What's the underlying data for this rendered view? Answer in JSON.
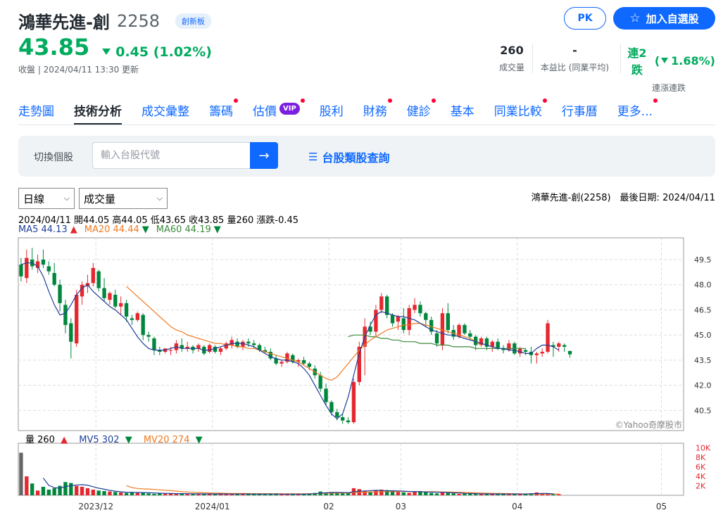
{
  "header": {
    "stock_name": "鴻華先進-創",
    "stock_code": "2258",
    "market_badge": "創新板",
    "price": "43.85",
    "change": "0.45 (1.02%)",
    "status_line": "收盤 | 2024/04/11 13:30 更新",
    "pk_label": "PK",
    "watchlist_label": "加入自選股",
    "stats": [
      {
        "value": "260",
        "label": "成交量"
      },
      {
        "value": "-",
        "label": "本益比 (同業平均)"
      }
    ],
    "streak": {
      "prefix": "連2跌",
      "value": "1.68%)",
      "open": "(",
      "label": "連漲連跌"
    }
  },
  "tabs": [
    {
      "label": "走勢圖",
      "active": false,
      "dot": false
    },
    {
      "label": "技術分析",
      "active": true,
      "dot": false
    },
    {
      "label": "成交彙整",
      "active": false,
      "dot": false
    },
    {
      "label": "籌碼",
      "active": false,
      "dot": true
    },
    {
      "label": "估價",
      "active": false,
      "dot": true,
      "vip": "VIP"
    },
    {
      "label": "股利",
      "active": false,
      "dot": false
    },
    {
      "label": "財務",
      "active": false,
      "dot": true
    },
    {
      "label": "健診",
      "active": false,
      "dot": true
    },
    {
      "label": "基本",
      "active": false,
      "dot": false
    },
    {
      "label": "同業比較",
      "active": false,
      "dot": true
    },
    {
      "label": "行事曆",
      "active": false,
      "dot": false
    },
    {
      "label": "更多...",
      "active": false,
      "dot": true
    }
  ],
  "search": {
    "label": "切換個股",
    "placeholder": "輸入台股代號",
    "category_link": "台股類股查詢"
  },
  "chart_controls": {
    "period": "日線",
    "indicator": "成交量",
    "title": "鴻華先進-創(2258)　最後日期: 2024/04/11",
    "ohlc": "2024/04/11 開44.05 高44.05 低43.65 收43.85 量260 漲跌-0.45",
    "ma5": "MA5 44.13",
    "ma20": "MA20 44.44",
    "ma60": "MA60 44.19",
    "vol": "量 260",
    "mv5": "MV5 302",
    "mv20": "MV20 274",
    "watermark": "©Yahoo奇摩股市"
  },
  "colors": {
    "up": "#e5282f",
    "down": "#00873c",
    "ma5": "#1f3f9a",
    "ma20": "#f07a22",
    "ma60": "#3b8a3b",
    "accent": "#0f69ff"
  },
  "chart_data": [
    {
      "type": "candlestick",
      "y_ticks": [
        40.5,
        42.0,
        43.5,
        45.0,
        46.5,
        48.0,
        49.5
      ],
      "ylim": [
        39.3,
        50.8
      ],
      "x_ticks": [
        "2023/12",
        "2024/01",
        "02",
        "03",
        "04",
        "05"
      ],
      "x_tick_index": [
        14,
        35,
        56,
        69,
        90,
        116
      ],
      "n_slots": 120,
      "candles": [
        [
          49.2,
          49.6,
          48.2,
          48.5
        ],
        [
          48.4,
          50.1,
          48.1,
          49.6
        ],
        [
          49.5,
          50.2,
          48.9,
          49.1
        ],
        [
          49.0,
          49.8,
          48.7,
          49.4
        ],
        [
          49.5,
          50.1,
          49.0,
          49.2
        ],
        [
          49.1,
          49.4,
          48.6,
          48.8
        ],
        [
          48.7,
          49.3,
          47.9,
          48.0
        ],
        [
          48.0,
          48.3,
          46.4,
          46.9
        ],
        [
          46.8,
          47.1,
          45.1,
          45.6
        ],
        [
          45.7,
          46.0,
          43.6,
          44.6
        ],
        [
          44.5,
          47.7,
          44.3,
          47.4
        ],
        [
          47.3,
          48.2,
          46.8,
          48.0
        ],
        [
          47.9,
          48.6,
          47.5,
          48.1
        ],
        [
          48.1,
          49.3,
          47.9,
          49.0
        ],
        [
          48.8,
          48.9,
          47.6,
          47.8
        ],
        [
          47.8,
          48.4,
          47.0,
          47.2
        ],
        [
          47.1,
          47.6,
          46.8,
          47.5
        ],
        [
          47.4,
          47.7,
          46.6,
          46.7
        ],
        [
          46.7,
          47.3,
          46.2,
          46.9
        ],
        [
          46.9,
          47.1,
          45.8,
          46.1
        ],
        [
          46.0,
          46.2,
          45.6,
          45.9
        ],
        [
          45.9,
          46.4,
          45.8,
          46.3
        ],
        [
          46.2,
          46.3,
          44.7,
          45.0
        ],
        [
          45.0,
          45.2,
          44.6,
          44.9
        ],
        [
          44.8,
          44.9,
          43.8,
          44.1
        ],
        [
          44.1,
          44.3,
          43.8,
          44.0
        ],
        [
          44.0,
          44.2,
          43.9,
          44.2
        ],
        [
          44.1,
          44.3,
          43.8,
          44.1
        ],
        [
          44.1,
          44.7,
          43.9,
          44.5
        ],
        [
          44.4,
          44.8,
          44.0,
          44.2
        ],
        [
          44.2,
          44.6,
          44.0,
          44.3
        ],
        [
          44.3,
          44.4,
          43.9,
          44.1
        ],
        [
          44.2,
          44.5,
          44.0,
          44.4
        ],
        [
          44.3,
          44.4,
          43.8,
          43.9
        ],
        [
          44.0,
          44.5,
          43.9,
          44.4
        ],
        [
          44.3,
          44.4,
          43.9,
          44.0
        ],
        [
          44.0,
          44.3,
          43.8,
          44.2
        ],
        [
          44.2,
          44.6,
          44.1,
          44.5
        ],
        [
          44.4,
          44.9,
          44.2,
          44.7
        ],
        [
          44.6,
          44.8,
          44.2,
          44.3
        ],
        [
          44.3,
          44.7,
          44.1,
          44.6
        ],
        [
          44.6,
          44.8,
          44.3,
          44.5
        ],
        [
          44.5,
          44.7,
          44.2,
          44.4
        ],
        [
          44.4,
          44.5,
          44.0,
          44.1
        ],
        [
          44.1,
          44.3,
          43.9,
          44.0
        ],
        [
          44.0,
          44.2,
          43.5,
          43.6
        ],
        [
          43.6,
          43.8,
          43.2,
          43.3
        ],
        [
          43.3,
          43.5,
          43.1,
          43.4
        ],
        [
          43.4,
          44.0,
          43.3,
          43.9
        ],
        [
          43.8,
          43.9,
          43.3,
          43.4
        ],
        [
          43.4,
          43.6,
          43.1,
          43.5
        ],
        [
          43.5,
          43.7,
          43.2,
          43.3
        ],
        [
          43.3,
          43.4,
          42.9,
          43.1
        ],
        [
          43.0,
          43.2,
          42.4,
          42.6
        ],
        [
          42.6,
          42.8,
          41.6,
          41.8
        ],
        [
          41.8,
          42.1,
          40.8,
          41.0
        ],
        [
          41.0,
          41.1,
          40.2,
          40.4
        ],
        [
          40.4,
          40.6,
          39.9,
          40.1
        ],
        [
          40.1,
          40.3,
          39.7,
          39.9
        ],
        [
          39.9,
          40.1,
          39.7,
          39.8
        ],
        [
          39.8,
          42.4,
          39.7,
          42.2
        ],
        [
          42.2,
          44.6,
          42.0,
          44.3
        ],
        [
          44.3,
          46.0,
          42.6,
          45.5
        ],
        [
          45.5,
          45.8,
          45.0,
          45.2
        ],
        [
          45.2,
          46.8,
          44.9,
          46.5
        ],
        [
          46.5,
          47.5,
          46.3,
          47.3
        ],
        [
          47.3,
          47.4,
          46.0,
          46.2
        ],
        [
          46.2,
          46.3,
          45.5,
          45.7
        ],
        [
          45.8,
          46.2,
          45.3,
          46.1
        ],
        [
          46.0,
          46.6,
          45.1,
          45.3
        ],
        [
          45.3,
          46.8,
          45.0,
          46.6
        ],
        [
          46.5,
          47.2,
          46.3,
          46.8
        ],
        [
          46.8,
          47.0,
          46.1,
          46.3
        ],
        [
          46.3,
          46.4,
          45.5,
          45.9
        ],
        [
          45.9,
          46.1,
          45.0,
          45.2
        ],
        [
          45.1,
          45.3,
          44.3,
          44.5
        ],
        [
          44.4,
          46.6,
          44.1,
          46.3
        ],
        [
          46.3,
          46.9,
          45.1,
          45.3
        ],
        [
          45.3,
          45.6,
          44.7,
          44.9
        ],
        [
          44.9,
          45.7,
          44.8,
          45.6
        ],
        [
          45.6,
          45.7,
          45.0,
          45.1
        ],
        [
          45.1,
          45.3,
          44.7,
          44.9
        ],
        [
          44.9,
          45.0,
          44.1,
          44.4
        ],
        [
          44.4,
          44.9,
          44.3,
          44.8
        ],
        [
          44.8,
          44.9,
          44.1,
          44.3
        ],
        [
          44.3,
          44.7,
          44.0,
          44.6
        ],
        [
          44.6,
          44.8,
          44.1,
          44.2
        ],
        [
          44.2,
          44.4,
          43.9,
          44.1
        ],
        [
          44.1,
          44.7,
          44.0,
          44.5
        ],
        [
          44.5,
          44.6,
          43.8,
          43.9
        ],
        [
          43.9,
          44.3,
          43.7,
          44.2
        ],
        [
          44.1,
          44.2,
          43.8,
          44.0
        ],
        [
          44.0,
          44.3,
          43.3,
          43.8
        ],
        [
          43.8,
          44.0,
          43.3,
          43.9
        ],
        [
          43.9,
          44.2,
          43.7,
          44.0
        ],
        [
          44.0,
          45.9,
          43.9,
          45.7
        ],
        [
          44.4,
          44.6,
          43.7,
          44.3
        ],
        [
          44.3,
          44.6,
          44.0,
          44.5
        ],
        [
          44.4,
          44.5,
          44.0,
          44.3
        ],
        [
          44.05,
          44.05,
          43.65,
          43.85
        ]
      ],
      "ma5": [
        49.2,
        49.3,
        49.3,
        49.1,
        48.5,
        47.6,
        46.8,
        46.2,
        46.3,
        46.8,
        47.4,
        47.8,
        48.0,
        47.6,
        47.3,
        47.0,
        46.7,
        46.5,
        46.2,
        45.9,
        45.4,
        44.9,
        44.5,
        44.2,
        44.1,
        44.1,
        44.1,
        44.2,
        44.3,
        44.2,
        44.2,
        44.2,
        44.2,
        44.1,
        44.1,
        44.2,
        44.3,
        44.4,
        44.5,
        44.5,
        44.5,
        44.4,
        44.3,
        44.1,
        43.9,
        43.7,
        43.6,
        43.5,
        43.5,
        43.4,
        43.3,
        43.0,
        42.6,
        42.0,
        41.4,
        40.8,
        40.3,
        40.0,
        40.3,
        41.3,
        42.6,
        43.9,
        44.9,
        45.6,
        46.2,
        46.4,
        46.3,
        46.2,
        46.1,
        46.1,
        46.0,
        45.9,
        45.7,
        45.5,
        45.3,
        45.2,
        45.1,
        45.0,
        45.0,
        44.9,
        44.8,
        44.7,
        44.6,
        44.5,
        44.4,
        44.3,
        44.2,
        44.2,
        44.1,
        44.1,
        44.0,
        43.9,
        43.9,
        44.2,
        44.4,
        44.4,
        44.3,
        44.1
      ],
      "ma20": [
        null,
        null,
        null,
        null,
        null,
        null,
        null,
        null,
        null,
        null,
        null,
        null,
        null,
        null,
        null,
        null,
        null,
        null,
        null,
        47.9,
        47.6,
        47.3,
        47.0,
        46.7,
        46.4,
        46.1,
        45.8,
        45.5,
        45.3,
        45.2,
        45.0,
        44.9,
        44.8,
        44.7,
        44.6,
        44.5,
        44.5,
        44.4,
        44.4,
        44.3,
        44.3,
        44.2,
        44.2,
        44.1,
        44.0,
        43.9,
        43.8,
        43.7,
        43.6,
        43.5,
        43.4,
        43.2,
        43.0,
        42.8,
        42.6,
        42.4,
        42.3,
        42.5,
        42.9,
        43.3,
        43.7,
        44.1,
        44.4,
        44.7,
        44.9,
        45.1,
        45.3,
        45.4,
        45.5,
        45.6,
        45.6,
        45.7,
        45.7,
        45.6,
        45.5,
        45.4,
        45.3,
        45.2,
        45.1,
        45.0,
        44.9,
        44.8,
        44.6,
        44.4
      ],
      "ma60": [
        null,
        null,
        null,
        null,
        null,
        null,
        null,
        null,
        null,
        null,
        null,
        null,
        null,
        null,
        null,
        null,
        null,
        null,
        null,
        null,
        null,
        null,
        null,
        null,
        null,
        null,
        null,
        null,
        null,
        null,
        null,
        null,
        null,
        null,
        null,
        null,
        null,
        null,
        null,
        null,
        null,
        null,
        null,
        null,
        null,
        null,
        null,
        null,
        null,
        null,
        null,
        null,
        null,
        null,
        null,
        null,
        null,
        null,
        null,
        44.9,
        45.0,
        45.0,
        45.0,
        44.9,
        44.9,
        44.8,
        44.8,
        44.7,
        44.7,
        44.6,
        44.6,
        44.6,
        44.5,
        44.5,
        44.5,
        44.4,
        44.4,
        44.4,
        44.3,
        44.3,
        44.3,
        44.3,
        44.2,
        44.2,
        44.2,
        44.2,
        44.2,
        44.2,
        44.2,
        44.2,
        44.2,
        44.19
      ],
      "volumes": [
        9000,
        4000,
        2500,
        1000,
        1800,
        1200,
        1500,
        2000,
        2800,
        2600,
        2000,
        1800,
        1500,
        1200,
        1000,
        900,
        800,
        700,
        600,
        500,
        700,
        500,
        600,
        400,
        300,
        400,
        350,
        300,
        400,
        300,
        350,
        300,
        250,
        300,
        280,
        260,
        300,
        280,
        250,
        300,
        260,
        240,
        280,
        260,
        300,
        270,
        250,
        230,
        300,
        260,
        240,
        300,
        350,
        500,
        800,
        600,
        700,
        500,
        400,
        600,
        1500,
        1300,
        900,
        700,
        1000,
        1200,
        1100,
        800,
        700,
        600,
        500,
        800,
        900,
        700,
        500,
        400,
        600,
        500,
        400,
        300,
        350,
        300,
        280,
        300,
        260,
        250,
        300,
        280,
        260,
        250,
        300,
        280,
        300,
        600,
        400,
        300,
        280,
        260
      ],
      "mv5": [
        null,
        null,
        null,
        null,
        3660,
        2100,
        1600,
        1500,
        1860,
        2020,
        2180,
        2240,
        2140,
        1820,
        1500,
        1280,
        1040,
        880,
        740,
        660,
        620,
        600,
        580,
        540,
        500,
        440,
        410,
        390,
        350,
        350,
        340,
        320,
        310,
        300,
        290,
        280,
        290,
        280,
        270,
        270,
        270,
        270,
        270,
        260,
        270,
        270,
        270,
        260,
        260,
        260,
        260,
        260,
        280,
        340,
        440,
        540,
        590,
        620,
        600,
        560,
        740,
        880,
        920,
        960,
        1060,
        1020,
        940,
        960,
        920,
        880,
        800,
        800,
        740,
        700,
        680,
        660,
        640,
        600,
        520,
        500,
        420,
        380,
        340,
        300,
        290,
        280,
        280,
        270,
        270,
        270,
        270,
        280,
        340,
        360,
        380,
        380,
        302
      ],
      "mv20": [
        null,
        null,
        null,
        null,
        null,
        null,
        null,
        null,
        null,
        null,
        null,
        null,
        null,
        null,
        null,
        null,
        null,
        null,
        null,
        2030,
        1620,
        1440,
        1350,
        1320,
        1240,
        1160,
        1080,
        985,
        875,
        760,
        700,
        640,
        590,
        540,
        500,
        470,
        450,
        420,
        400,
        390,
        380,
        370,
        360,
        350,
        345,
        340,
        335,
        330,
        330,
        325,
        325,
        330,
        340,
        360,
        390,
        420,
        450,
        470,
        480,
        500,
        560,
        620,
        660,
        680,
        720,
        760,
        790,
        800,
        810,
        810,
        780,
        780,
        780,
        770,
        760,
        740,
        720,
        700,
        670,
        640,
        600,
        560,
        520,
        480,
        450,
        420,
        400,
        380,
        360,
        340,
        320,
        300,
        300,
        295,
        290,
        285,
        282,
        274
      ],
      "vol_ticks": [
        "2K",
        "4K",
        "6K",
        "8K",
        "10K"
      ]
    }
  ]
}
